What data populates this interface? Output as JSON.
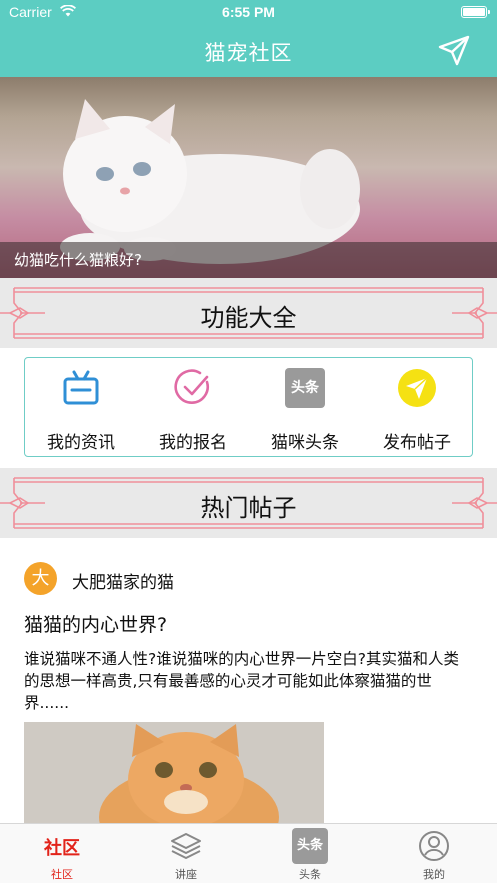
{
  "status_bar": {
    "carrier": "Carrier",
    "time": "6:55 PM"
  },
  "nav": {
    "title": "猫宠社区",
    "send_icon": "send-icon"
  },
  "banner": {
    "caption": "幼猫吃什么猫粮好?"
  },
  "sections": {
    "features_title": "功能大全",
    "hot_title": "热门帖子"
  },
  "features": [
    {
      "label": "我的资讯",
      "icon": "tv-icon",
      "color": "#2f8fd6"
    },
    {
      "label": "我的报名",
      "icon": "check-circle-icon",
      "color": "#e06aa4"
    },
    {
      "label": "猫咪头条",
      "icon": "headline-icon",
      "icon_text": "头条",
      "color": "#9a9a9a"
    },
    {
      "label": "发布帖子",
      "icon": "send-circle-icon",
      "color": "#f5e113"
    }
  ],
  "post": {
    "avatar_char": "大",
    "author": "大肥猫家的猫",
    "title": "猫猫的内心世界?",
    "body": "谁说猫咪不通人性?谁说猫咪的内心世界一片空白?其实猫和人类的思想一样高贵,只有最善感的心灵才可能如此体察猫猫的世界......"
  },
  "tabs": [
    {
      "label": "社区",
      "icon_text": "社区",
      "icon": "community-text-icon",
      "active": true
    },
    {
      "label": "讲座",
      "icon": "layers-icon",
      "active": false
    },
    {
      "label": "头条",
      "icon": "headline-icon",
      "icon_text": "头条",
      "active": false
    },
    {
      "label": "我的",
      "icon": "user-circle-icon",
      "active": false
    }
  ],
  "colors": {
    "accent": "#5ccdc2",
    "active_tab": "#e2231a",
    "frame": "#f08f9a"
  }
}
